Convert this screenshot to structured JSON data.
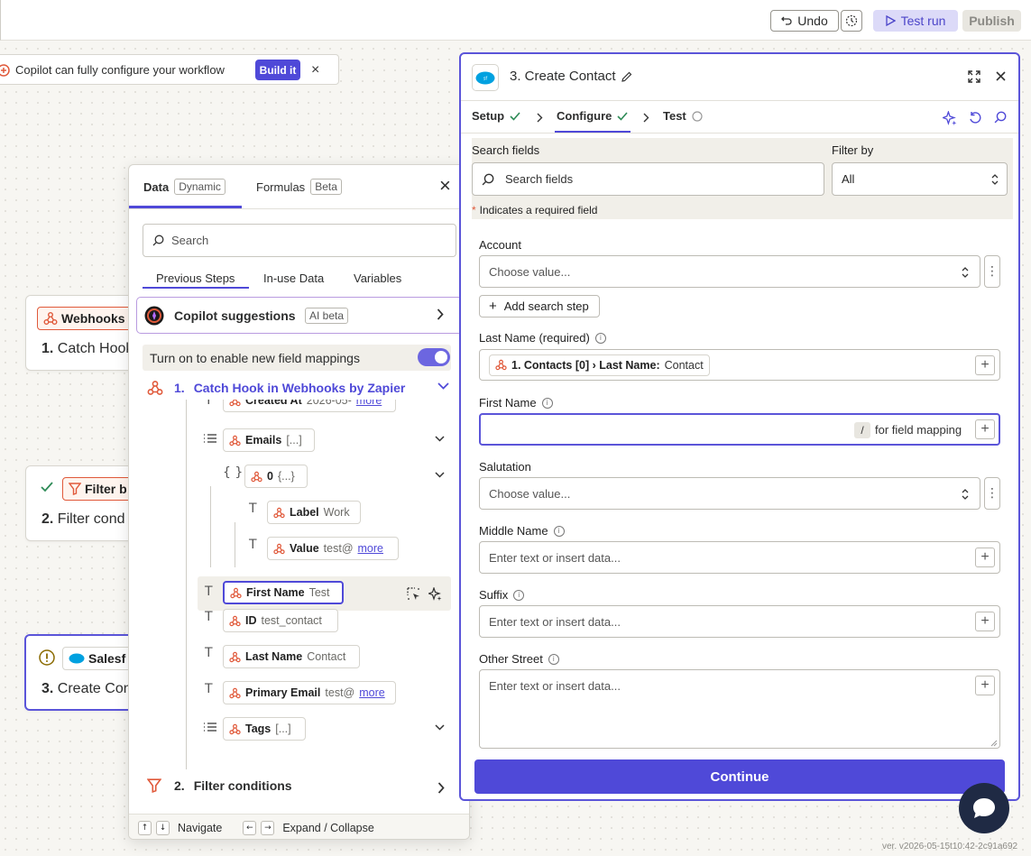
{
  "topbar": {
    "undo_label": "Undo",
    "testrun_label": "Test run",
    "publish_label": "Publish"
  },
  "banner": {
    "text": "Copilot can fully configure your workflow",
    "build_label": "Build it",
    "close": "×"
  },
  "canvas_nodes": [
    {
      "chip": "Webhooks",
      "title_num": "1.",
      "title": "Catch Hook"
    },
    {
      "chip": "Filter b",
      "title_num": "2.",
      "title": "Filter cond"
    },
    {
      "chip": "Salesf",
      "title_num": "3.",
      "title": "Create Con"
    }
  ],
  "data_panel": {
    "tab_data": "Data",
    "tab_data_tag": "Dynamic",
    "tab_formulas": "Formulas",
    "tab_formulas_tag": "Beta",
    "close": "×",
    "search_placeholder": "Search",
    "subtabs": [
      "Previous Steps",
      "In-use Data",
      "Variables"
    ],
    "copilot": {
      "label": "Copilot suggestions",
      "tag": "AI beta"
    },
    "toggle_text": "Turn on to enable new field mappings",
    "step1": {
      "num": "1.",
      "label": "Catch Hook in Webhooks by Zapier"
    },
    "items": [
      {
        "name": "Created At",
        "value": "2026-05-",
        "more": "more"
      },
      {
        "name": "Emails",
        "value": "[...]"
      },
      {
        "name": "0",
        "value": "{...}"
      },
      {
        "name": "Label",
        "value": "Work"
      },
      {
        "name": "Value",
        "value": "test@",
        "more": "more"
      },
      {
        "name": "First Name",
        "value": "Test"
      },
      {
        "name": "ID",
        "value": "test_contact"
      },
      {
        "name": "Last Name",
        "value": "Contact"
      },
      {
        "name": "Primary Email",
        "value": "test@",
        "more": "more"
      },
      {
        "name": "Tags",
        "value": "[...]"
      }
    ],
    "step2": {
      "num": "2.",
      "label": "Filter conditions"
    },
    "footer": {
      "navigate": "Navigate",
      "expand": "Expand / Collapse"
    }
  },
  "right_panel": {
    "title": "3. Create Contact",
    "tabs": [
      "Setup",
      "Configure",
      "Test"
    ],
    "search_fields_label": "Search fields",
    "search_fields_placeholder": "Search fields",
    "filter_by_label": "Filter by",
    "filter_by_value": "All",
    "required_note": "Indicates a required field",
    "required_star": "*",
    "account_label": "Account",
    "choose_value": "Choose value...",
    "add_search_step": "Add search step",
    "last_name_label": "Last Name (required)",
    "last_name_chip": {
      "prefix": "1. Contacts [0] › Last Name:",
      "value": "Contact"
    },
    "first_name_label": "First Name",
    "slash_key": "/",
    "field_mapping_hint": "for field mapping",
    "salutation_label": "Salutation",
    "middle_name_label": "Middle Name",
    "suffix_label": "Suffix",
    "other_street_label": "Other Street",
    "enter_text_placeholder": "Enter text or insert data...",
    "continue_label": "Continue"
  },
  "version": "ver. v2026-05-15t10:42-2c91a692",
  "colors": {
    "accent": "#4f49d8",
    "zapier_orange": "#e0593a",
    "salesforce_blue": "#00a1e0",
    "check_green": "#2e8b57"
  }
}
